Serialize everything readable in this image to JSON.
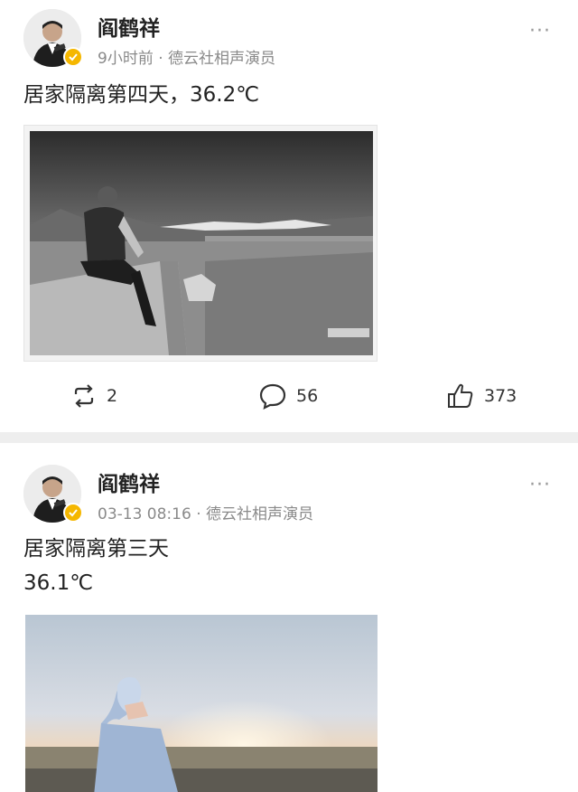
{
  "posts": [
    {
      "author": "阎鹤祥",
      "meta": "9小时前 · 德云社相声演员",
      "text_lines": [
        "居家隔离第四天，36.2℃"
      ],
      "more": "···",
      "actions": {
        "repost": "2",
        "comment": "56",
        "like": "373"
      }
    },
    {
      "author": "阎鹤祥",
      "meta": "03-13 08:16 · 德云社相声演员",
      "text_lines": [
        "居家隔离第三天",
        "36.1℃"
      ],
      "more": "···"
    }
  ],
  "icons": {
    "repost": "repost-icon",
    "comment": "comment-icon",
    "like": "thumbs-up-icon",
    "verified": "verified-badge-icon"
  }
}
